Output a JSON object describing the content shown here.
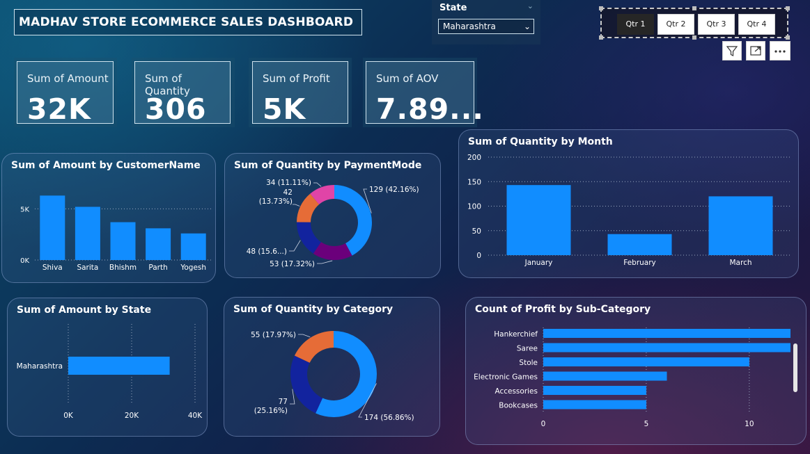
{
  "header": {
    "title": "MADHAV STORE ECOMMERCE SALES DASHBOARD"
  },
  "state_slicer": {
    "label": "State",
    "selected": "Maharashtra"
  },
  "quarter_slicer": {
    "options": [
      "Qtr 1",
      "Qtr 2",
      "Qtr 3",
      "Qtr 4"
    ],
    "selected": "Qtr 1"
  },
  "visual_icons": [
    "filter-icon",
    "focus-mode-icon",
    "more-options-icon"
  ],
  "kpis": [
    {
      "label": "Sum of Amount",
      "value": "32K"
    },
    {
      "label": "Sum of Quantity",
      "value": "306"
    },
    {
      "label": "Sum of Profit",
      "value": "5K"
    },
    {
      "label": "Sum of AOV",
      "value": "7.89..."
    }
  ],
  "colors": {
    "bar": "#118DFF",
    "accent_dark": "#12239E",
    "orange": "#E66C37",
    "purple": "#6B007B",
    "pink": "#E044A7"
  },
  "chart_data": [
    {
      "id": "amount_by_customer",
      "type": "bar",
      "title": "Sum of Amount by CustomerName",
      "categories": [
        "Shiva",
        "Sarita",
        "Bhishm",
        "Parth",
        "Yogesh"
      ],
      "values": [
        6300,
        5200,
        3700,
        3100,
        2600
      ],
      "ylim": [
        0,
        7000
      ],
      "yticks": [
        "0K",
        "5K"
      ],
      "grid": true
    },
    {
      "id": "quantity_by_paymentmode",
      "type": "pie",
      "donut": true,
      "title": "Sum of Quantity by PaymentMode",
      "values": [
        129,
        53,
        48,
        42,
        34
      ],
      "colors": [
        "#118DFF",
        "#6B007B",
        "#12239E",
        "#E66C37",
        "#E044A7"
      ],
      "labels": [
        "129 (42.16%)",
        "53 (17.32%)",
        "48 (15.6...)",
        "42\n(13.73%)",
        "34 (11.11%)"
      ]
    },
    {
      "id": "quantity_by_month",
      "type": "bar",
      "title": "Sum of Quantity by Month",
      "categories": [
        "January",
        "February",
        "March"
      ],
      "values": [
        143,
        43,
        120
      ],
      "ylim": [
        0,
        200
      ],
      "yticks": [
        "0",
        "50",
        "100",
        "150",
        "200"
      ],
      "grid": true
    },
    {
      "id": "amount_by_state",
      "type": "bar",
      "orientation": "horizontal",
      "title": "Sum of Amount by State",
      "categories": [
        "Maharashtra"
      ],
      "values": [
        32000
      ],
      "xlim": [
        0,
        40000
      ],
      "xticks": [
        "0K",
        "20K",
        "40K"
      ],
      "grid": true
    },
    {
      "id": "quantity_by_category",
      "type": "pie",
      "donut": true,
      "title": "Sum of Quantity by Category",
      "values": [
        174,
        77,
        55
      ],
      "colors": [
        "#118DFF",
        "#12239E",
        "#E66C37"
      ],
      "labels": [
        "174 (56.86%)",
        "77\n(25.16%)",
        "55 (17.97%)"
      ]
    },
    {
      "id": "profit_count_by_subcategory",
      "type": "bar",
      "orientation": "horizontal",
      "title": "Count of Profit by Sub-Category",
      "categories": [
        "Hankerchief",
        "Saree",
        "Stole",
        "Electronic Games",
        "Accessories",
        "Bookcases"
      ],
      "values": [
        12,
        12,
        10,
        6,
        5,
        5
      ],
      "xlim": [
        0,
        12
      ],
      "xticks": [
        "0",
        "5",
        "10"
      ],
      "grid": true
    }
  ]
}
